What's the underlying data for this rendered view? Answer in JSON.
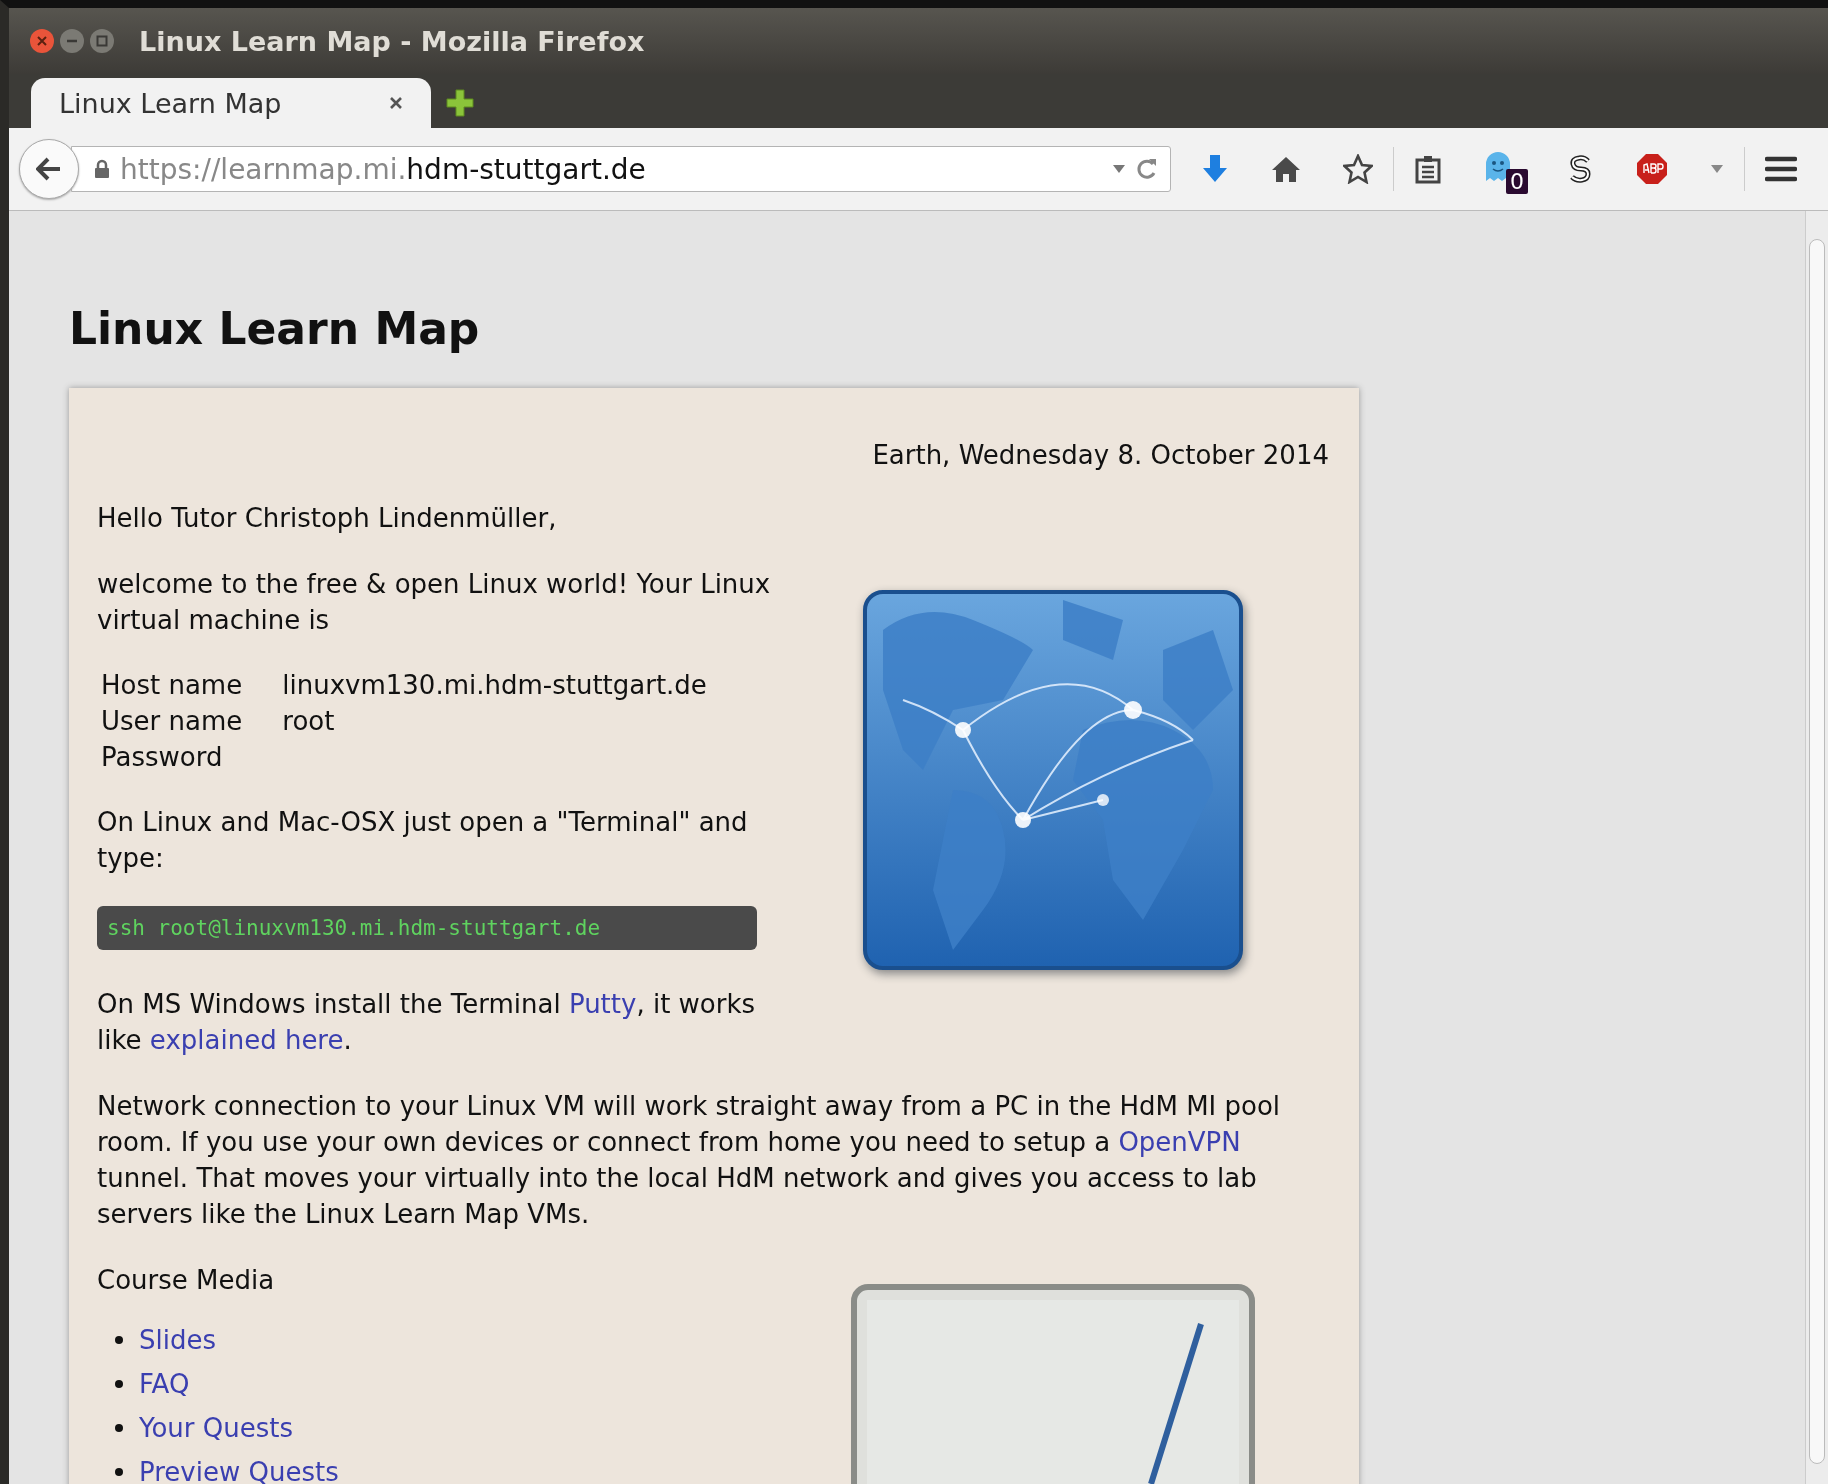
{
  "window": {
    "title": "Linux Learn Map - Mozilla Firefox"
  },
  "tabs": [
    {
      "label": "Linux Learn Map",
      "selected": true
    }
  ],
  "address_bar": {
    "url_prefix": "https://learnmap.mi.",
    "url_domain": "hdm-stuttgart.de"
  },
  "toolbar": {
    "ghost_badge": "0"
  },
  "page": {
    "heading": "Linux Learn Map",
    "date": "Earth, Wednesday 8. October 2014",
    "greeting": "Hello Tutor Christoph Lindenmüller,",
    "intro": "welcome to the free & open Linux world! Your Linux virtual machine is",
    "credentials": [
      {
        "label": "Host name",
        "value": "linuxvm130.mi.hdm-stuttgart.de"
      },
      {
        "label": "User name",
        "value": "root"
      },
      {
        "label": "Password"
      }
    ],
    "terminal_hint": "On Linux and Mac-OSX just open a \"Terminal\" and type:",
    "command": "ssh root@linuxvm130.mi.hdm-stuttgart.de",
    "windows_hint": [
      {
        "kind": "text",
        "text": "On MS Windows install the Terminal "
      },
      {
        "kind": "link",
        "text": "Putty"
      },
      {
        "kind": "text",
        "text": ", it works like "
      },
      {
        "kind": "link",
        "text": "explained here"
      },
      {
        "kind": "text",
        "text": "."
      }
    ],
    "network_hint": [
      {
        "kind": "text",
        "text": "Network connection to your Linux VM will work straight away from a PC in the HdM MI pool room. If you use your own devices or connect from home you need to setup a "
      },
      {
        "kind": "link",
        "text": "OpenVPN"
      },
      {
        "kind": "text",
        "text": " tunnel. That moves your virtually into the local HdM network and gives you access to lab servers like the Linux Learn Map VMs."
      }
    ],
    "course_media_heading": "Course Media",
    "course_media": [
      "Slides",
      "FAQ",
      "Your Quests",
      "Preview Quests"
    ]
  }
}
